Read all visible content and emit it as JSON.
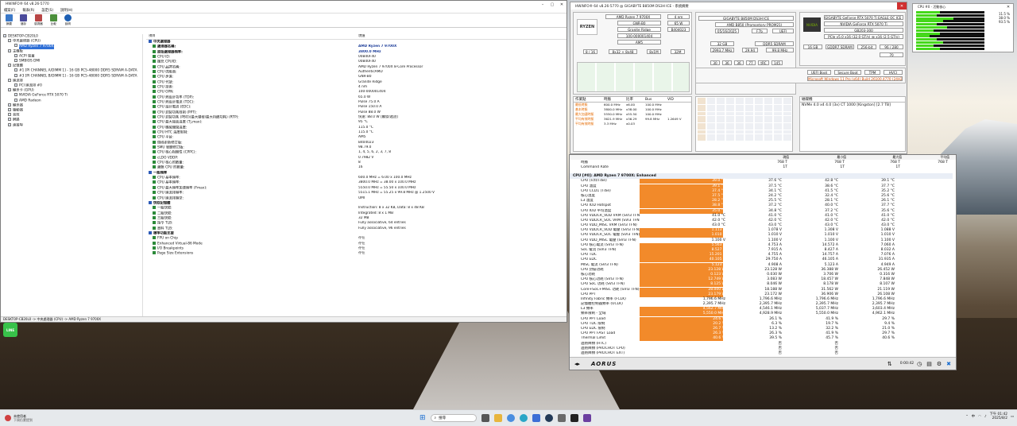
{
  "aida": {
    "title": "HWiNFO® 64 v8.26-5770",
    "menu": [
      "檔案(F)",
      "報表(R)",
      "設定(S)",
      "說明(H)"
    ],
    "toolbar": [
      "摘要",
      "儲存",
      "感測器",
      "比較",
      "說明"
    ],
    "tree": [
      "DESKTOP-CB20L0",
      "中央處理器 (CPU)",
      "AMD Ryzen 7 9700X",
      "主機板",
      "ACPI 裝置",
      "SMBIOS DMI",
      "記憶體",
      "#1 [PI CHANNEL A/DIMM 1] - 16 GB PC5-48000 DDR5 SDRAM A-DATA",
      "#3 [PI CHANNEL B/DIMM 1] - 16 GB PC5-48000 DDR5 SDRAM A-DATA",
      "匯流排",
      "PCI 匯流排 #0",
      "顯示卡 (GPU)",
      "NVIDIA GeForce RTX 5070 Ti",
      "AMD Radeon",
      "顯示器",
      "驅動器",
      "音效",
      "網路",
      "連接埠"
    ],
    "col_headers": [
      "項目",
      "現值"
    ],
    "details": [
      {
        "k": "中央處理器",
        "v": "",
        "h": true
      },
      {
        "k": "處理器名稱:",
        "v": "AMD Ryzen 7 9700X",
        "b": true
      },
      {
        "k": "原始處理器頻率:",
        "v": "3800.0 MHz",
        "b": true
      },
      {
        "k": "",
        "v": ""
      },
      {
        "k": "CPU ID:",
        "v": "00B40F40"
      },
      {
        "k": "擴充 CPUID:",
        "v": "00B40F40"
      },
      {
        "k": "CPU 品牌名稱:",
        "v": "AMD Ryzen 7 9700X 8-Core Processor"
      },
      {
        "k": "CPU 供應商:",
        "v": "AuthenticAMD"
      },
      {
        "k": "CPU 步進:",
        "v": "GNR-B0"
      },
      {
        "k": "CPU 代號:",
        "v": "Granite Ridge"
      },
      {
        "k": "CPU 技術:",
        "v": "4 nm"
      },
      {
        "k": "CPU OPN:",
        "v": "100-000001404"
      },
      {
        "k": "CPU 熱設計功率 (TDP):",
        "v": "65.0 W"
      },
      {
        "k": "CPU 熱設計電流 (TDC):",
        "v": "Pulse 75.0 A"
      },
      {
        "k": "CPU 設計電流 (EDC):",
        "v": "Pulse 150.0 A"
      },
      {
        "k": "CPU 封裝功耗限制 (PPT):",
        "v": "Pulse 88.0 W"
      },
      {
        "k": "CPU 封裝功耗 (PBO)(最大爆發/最大持續功耗) (RTP):",
        "v": "快速: 88.0 W [觸發/遞迴]"
      },
      {
        "k": "CPU 最大接面溫度 (Tj,max):",
        "v": "95 °C"
      },
      {
        "k": "CPU 機械關閉溫度:",
        "v": "115.0 °C"
      },
      {
        "k": "CPU HTC 溫度限制:",
        "v": "115.0 °C"
      },
      {
        "k": "CPU 平台:",
        "v": "AM5"
      },
      {
        "k": "微碼更新修訂版:",
        "v": "B404023"
      },
      {
        "k": "SMU 韌體修訂版:",
        "v": "98.79.0"
      },
      {
        "k": "CPU 核心相關性 (CPPC):",
        "v": "1, 4, 5, 6, 2, 3, 7, 8"
      },
      {
        "k": "cLDO VDDP:",
        "v": "0.7982 V"
      },
      {
        "k": "",
        "v": ""
      },
      {
        "k": "CPU 核心的數量:",
        "v": "8"
      },
      {
        "k": "邏輯 CPU 的數量:",
        "v": "16"
      },
      {
        "k": "",
        "v": ""
      },
      {
        "k": "一般頻率",
        "v": "",
        "h": true
      },
      {
        "k": "CPU 基本頻率:",
        "v": "600.0 MHz = 6.00 x 100.0 MHz"
      },
      {
        "k": "CPU 基本頻率:",
        "v": "3800.0 MHz = 38.00 x 100.0 MHz"
      },
      {
        "k": "CPU 最大頻率加速頻率 (Fmax):",
        "v": "5550.0 MHz = 55.50 x 100.0 MHz"
      },
      {
        "k": "CPU 匯流排頻率:",
        "v": "5515.1 MHz = 55.25 x 99.8 MHz @ 1.2500 V"
      },
      {
        "k": "",
        "v": ""
      },
      {
        "k": "CPU 匯流排類型:",
        "v": "UMI"
      },
      {
        "k": "",
        "v": ""
      },
      {
        "k": "快取記憶體",
        "v": "",
        "h": true
      },
      {
        "k": "一級快取:",
        "v": "Instruction: 8 x 32 KB, Data: 8 x 48 KB"
      },
      {
        "k": "二級快取:",
        "v": "Integrated: 8 x 1 MB"
      },
      {
        "k": "三級快取:",
        "v": "32 MB"
      },
      {
        "k": "指令 TLB:",
        "v": "Fully associative, 64 entries"
      },
      {
        "k": "資料 TLB:",
        "v": "Fully associative, 96 entries"
      },
      {
        "k": "",
        "v": ""
      },
      {
        "k": "標準功能支援",
        "v": "",
        "h": true
      },
      {
        "k": "FPU on Chip",
        "v": "存在"
      },
      {
        "k": "Enhanced Virtual-86 Mode",
        "v": "存在"
      },
      {
        "k": "I/O Breakpoints",
        "v": "存在"
      },
      {
        "k": "Page Size Extensions",
        "v": "存在"
      }
    ],
    "status": "DESKTOP-CB20L0 -> 中央處理器 (CPU) -> AMD Ryzen 7 9700X"
  },
  "hw": {
    "title": "HWiNFO® 64 v8.26-5770 @ GIGABYTE B850M DS3H ICE - 系統摘要",
    "cpu": {
      "name": "AMD Ryzen 7 9700X",
      "nm": "4 nm",
      "stepping": "GNR-B0",
      "tdp": "65 W",
      "codename": "Granite Ridge",
      "mcu": "B404023",
      "sspec": "100-000001404",
      "platform": "AM5",
      "cores": "8 / 16",
      "l1": "8x32 + 8x48",
      "l2": "8x1M",
      "l3": "32M"
    },
    "mb": {
      "name": "GIGABYTE B850M DS3H ICE",
      "chipset": "AMD B850 (Promontory PROM21)",
      "bios_date": "05/16/2025",
      "bios_ver": "F7b",
      "uefi": "UEFI"
    },
    "mem": {
      "size": "32 GB",
      "type": "DDR5 SDRAM",
      "clock": "2993.7 MHz",
      "ratio": "29.94",
      "bus": "99.8 MHz",
      "timing": [
        "30",
        "36",
        "36",
        "77",
        "tRC",
        "145"
      ],
      "module": "#1 [PI CHANNEL A/DIMM 1]: A-DATA Technology AX5U6000C3016G-B"
    },
    "gpu": {
      "name": "GIGABYTE GeForce RTX 5070 Ti EAGLE OC ICE SFF 16G",
      "chip": "NVIDIA GeForce RTX 5070 Ti",
      "model": "GB203-300",
      "pcie": "PCIe v5.0 x16 (32.0 GT/s) @ x16 (2.5 GT/s)",
      "vram": "16 GB",
      "vtype": "GDDR7 SDRAM",
      "vbus": "256-bit",
      "rops": "96 / 280",
      "sm": "70"
    },
    "os": {
      "name": "Microsoft Windows 11 Pro (x64) Build 26100.4770 (24H2)",
      "boot": "UEFI Boot",
      "secure": "Secure Boot",
      "tpm": "TPM",
      "hvci": "HVCI"
    },
    "ops_cols": [
      "作業點",
      "時脈",
      "比率",
      "Bus",
      "VID"
    ],
    "ops": [
      {
        "n": "最低時脈",
        "c": "600.0 MHz",
        "r": "x6.00",
        "b": "100.0 MHz",
        "v": ""
      },
      {
        "n": "基本時脈",
        "c": "3800.0 MHz",
        "r": "x38.00",
        "b": "100.0 MHz",
        "v": ""
      },
      {
        "n": "最大加速時脈",
        "c": "5550.0 MHz",
        "r": "x55.50",
        "b": "100.0 MHz",
        "v": ""
      },
      {
        "n": "平均有效時脈",
        "c": "3621.9 MHz",
        "r": "x36.29",
        "b": "99.8 MHz",
        "v": "1.2649 V"
      },
      {
        "n": "平均有效時脈",
        "c": "3.3 MHz",
        "r": "x0.03",
        "b": "",
        "v": ""
      }
    ],
    "drive_col": "磁碟機",
    "drive": "NVMe 4.0 x4 4.0 (3x)        CT 1000 [Kingston] [2.7 TB]"
  },
  "sensor": {
    "header": [
      "現值",
      "最小值",
      "最大值",
      "平均值"
    ],
    "rows_top": [
      {
        "n": "時脈",
        "a": "768 T",
        "b": "768 T",
        "c": "768 T",
        "d": "768 T"
      },
      {
        "n": "Command Rate",
        "a": "1T",
        "b": "1T",
        "c": "1T",
        "d": ""
      }
    ],
    "section": "CPU [#0]: AMD Ryzen 7 9700X: Enhanced",
    "rows": [
      {
        "n": "CPU (Tctl/Tdie)",
        "p": 95,
        "t": "39.0 °C",
        "a": "37.6 °C",
        "b": "42.8 °C",
        "c": "39.1 °C"
      },
      {
        "n": "CPU 溫度",
        "p": 95,
        "t": "39.1 °C",
        "a": "37.5 °C",
        "b": "38.6 °C",
        "c": "37.7 °C"
      },
      {
        "n": "CPU CCD1 (Tdie)",
        "p": 95,
        "t": "37.4 °C",
        "a": "34.1 °C",
        "b": "41.5 °C",
        "c": "35.2 °C"
      },
      {
        "n": "核心溫度",
        "p": 95,
        "t": "37.5 °C",
        "a": "24.2 °C",
        "b": "32.4 °C",
        "c": "25.6 °C"
      },
      {
        "n": "L3 溫度",
        "p": 95,
        "t": "28.2 °C",
        "a": "25.5 °C",
        "b": "28.1 °C",
        "c": "26.1 °C"
      },
      {
        "n": "CPU IOD Hotspot",
        "p": 95,
        "t": "38.8 °C",
        "a": "37.2 °C",
        "b": "40.0 °C",
        "c": "37.7 °C"
      },
      {
        "n": "CPU IOD 平均溫度",
        "p": 95,
        "t": "35.0 °C",
        "a": "34.8 °C",
        "b": "37.2 °C",
        "c": "35.6 °C"
      },
      {
        "n": "CPU VDDCR_VDD VRM (SVI3 TFN)",
        "p": 0,
        "t": "41.0 °C",
        "a": "41.0 °C",
        "b": "41.0 °C",
        "c": "41.0 °C"
      },
      {
        "n": "CPU VDDCR_SOC VRM (SVI3 TFN)",
        "p": 0,
        "t": "42.0 °C",
        "a": "42.0 °C",
        "b": "42.0 °C",
        "c": "42.0 °C"
      },
      {
        "n": "CPU VDD_MISC VRM (SVI3 TFN)",
        "p": 0,
        "t": "43.0 °C",
        "a": "43.0 °C",
        "b": "43.0 °C",
        "c": "43.0 °C"
      },
      {
        "n": "CPU VDDCR_VDD 電壓 (SVI3 TFN)",
        "p": 95,
        "t": "1.113 V",
        "a": "1.078 V",
        "b": "1.308 V",
        "c": "1.088 V"
      },
      {
        "n": "CPU VDDCR_SOC 電壓 (SVI3 TFN)",
        "p": 95,
        "t": "1.010 V",
        "a": "1.010 V",
        "b": "1.010 V",
        "c": "1.010 V"
      },
      {
        "n": "CPU VDD_MISC 電壓 (SVI3 TFN)",
        "p": 0,
        "t": "1.100 V",
        "a": "1.100 V",
        "b": "1.100 V",
        "c": "1.100 V"
      },
      {
        "n": "CPU 核心電流 (SVI3 TFN)",
        "p": 95,
        "t": "5.563 A",
        "a": "4.753 A",
        "b": "14.572 A",
        "c": "7.060 A"
      },
      {
        "n": "SoC 電流 (SVI3 TFN)",
        "p": 95,
        "t": "8.527 A",
        "a": "7.915 A",
        "b": "8.427 A",
        "c": "8.032 A"
      },
      {
        "n": "CPU TDC",
        "p": 95,
        "t": "15.201 A",
        "a": "4.755 A",
        "b": "14.757 A",
        "c": "7.076 A"
      },
      {
        "n": "CPU EDC",
        "p": 95,
        "t": "40.105 A",
        "a": "29.750 A",
        "b": "46.105 A",
        "c": "31.935 A"
      },
      {
        "n": "MISC 電流 (SVI3 TFN)",
        "p": 95,
        "t": "5.123 A",
        "a": "4.908 A",
        "b": "5.123 A",
        "c": "4.949 A"
      },
      {
        "n": "CPU 封裝功耗",
        "p": 95,
        "t": "23.128 W",
        "a": "23.128 W",
        "b": "36.388 W",
        "c": "26.452 W"
      },
      {
        "n": "核心功耗",
        "p": 95,
        "t": "0.123 W",
        "a": "0.030 W",
        "b": "3.706 W",
        "c": "0.316 W"
      },
      {
        "n": "CPU 核心功耗 (SVI3 TFN)",
        "p": 95,
        "t": "12.749 W",
        "a": "3.083 W",
        "b": "18.457 W",
        "c": "7.848 W"
      },
      {
        "n": "CPU SoC 功耗 (SVI3 TFN)",
        "p": 95,
        "t": "8.125 W",
        "a": "8.046 W",
        "b": "8.178 W",
        "c": "8.107 W"
      },
      {
        "n": "Core+SoC+MISC 功耗 (SVI3 TFN)",
        "p": 95,
        "t": "28.000 W",
        "a": "18.188 W",
        "b": "31.562 W",
        "c": "21.119 W"
      },
      {
        "n": "CPU PPT",
        "p": 95,
        "t": "23.179 W",
        "a": "23.172 W",
        "b": "36.906 W",
        "c": "26.108 W"
      },
      {
        "n": "Infinity Fabric 頻率 (FCLK)",
        "p": 0,
        "t": "1,796.6 MHz",
        "a": "1,796.6 MHz",
        "b": "1,796.6 MHz",
        "c": "1,796.6 MHz"
      },
      {
        "n": "記憶體控制器頻率 (UCLK)",
        "p": 0,
        "t": "2,395.7 MHz",
        "a": "2,395.7 MHz",
        "b": "2,395.7 MHz",
        "c": "2,395.7 MHz"
      },
      {
        "n": "L3 頻率",
        "p": 95,
        "t": "4,562.7 MHz",
        "a": "4,546.1 MHz",
        "b": "5,037.7 MHz",
        "c": "3,603.4 MHz"
      },
      {
        "n": "頻率限制 - 全域",
        "p": 95,
        "t": "5,550.0 MHz",
        "a": "4,928.9 MHz",
        "b": "5,550.0 MHz",
        "c": "4,962.1 MHz"
      },
      {
        "n": "CPU PPT Load",
        "p": 95,
        "t": "24.6 %",
        "a": "26.1 %",
        "b": "41.9 %",
        "c": "29.7 %"
      },
      {
        "n": "CPU TDC 限制",
        "p": 95,
        "t": "20.2 %",
        "a": "6.3 %",
        "b": "19.7 %",
        "c": "9.4 %"
      },
      {
        "n": "CPU EDC 限制",
        "p": 95,
        "t": "26.7 %",
        "a": "13.2 %",
        "b": "32.2 %",
        "c": "21.0 %"
      },
      {
        "n": "CPU PPT FAST Load",
        "p": 95,
        "t": "26.3 %",
        "a": "26.3 %",
        "b": "41.9 %",
        "c": "29.7 %"
      },
      {
        "n": "Thermal Limit",
        "p": 95,
        "t": "40.6 %",
        "a": "39.5 %",
        "b": "45.7 %",
        "c": "40.6 %"
      },
      {
        "n": "過熱降頻 (HTC)",
        "p": 0,
        "t": "",
        "a": "否",
        "b": "否",
        "c": ""
      },
      {
        "n": "過熱降頻 (PROCHOT CPU)",
        "p": 0,
        "t": "",
        "a": "否",
        "b": "否",
        "c": ""
      },
      {
        "n": "過熱降頻 (PROCHOT EXT)",
        "p": 0,
        "t": "",
        "a": "否",
        "b": "否",
        "c": ""
      }
    ],
    "timer": "0:00:42"
  },
  "monitor": {
    "title": "CPU #0 - 活動核心",
    "pcts": [
      "11.5 %",
      "38.0 %",
      "93.5 %"
    ],
    "bars": [
      0.35,
      0.3,
      0.55,
      0.4,
      0.3,
      0.45,
      0.25,
      0.35,
      0.2,
      0.3,
      0.4,
      0.25,
      0.35
    ]
  },
  "sys_tray": {
    "weather": "未使用者",
    "weather_sub": "下周仍蒙提到",
    "lang": "中",
    "time": "下午 01:42",
    "date": "2025/8/2"
  },
  "search": {
    "placeholder": "搜尋"
  },
  "colors": {
    "accent": "#f28a2a",
    "highlight": "#2f6fd6",
    "ok": "#2aa52a"
  }
}
